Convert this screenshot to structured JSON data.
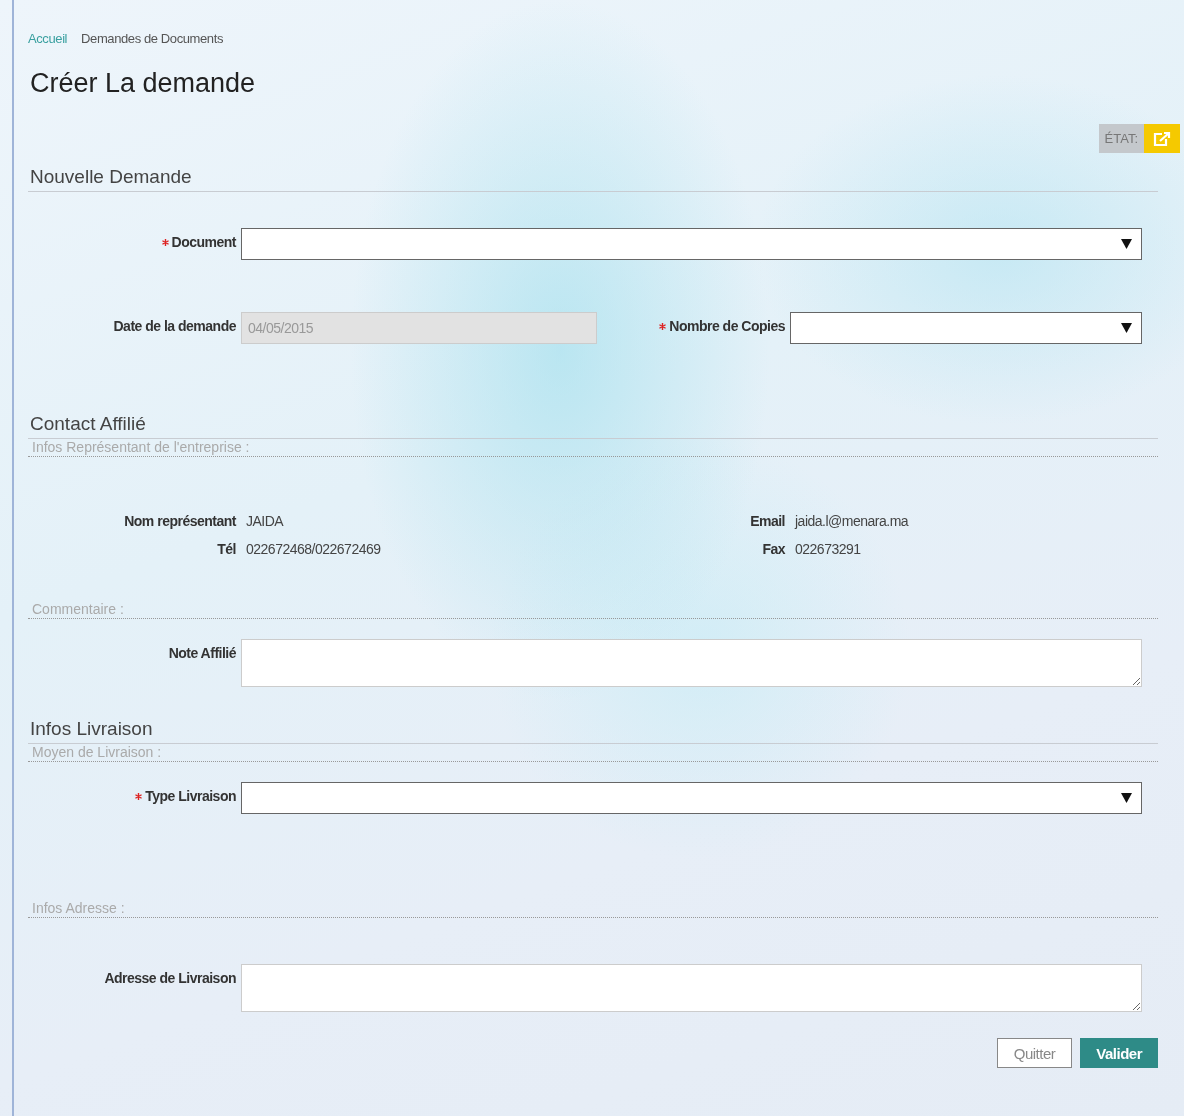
{
  "breadcrumb": [
    {
      "label": "Accueil",
      "kind": "link"
    },
    {
      "label": "Demandes de Documents",
      "kind": "current"
    }
  ],
  "title": "Créer La demande",
  "status": {
    "label": "ÉTAT:"
  },
  "sections": [
    {
      "title": "Nouvelle Demande",
      "groups": [
        {
          "rows": [
            [
              {
                "kind": "select",
                "label": "Document",
                "required": true
              }
            ],
            [
              {
                "kind": "text",
                "label": "Date de la demande",
                "value": "04/05/2015",
                "required": false,
                "disabled": true
              },
              {
                "kind": "select",
                "label": "Nombre de Copies",
                "required": true
              }
            ]
          ]
        }
      ]
    },
    {
      "title": "Contact Affilié",
      "groups": [
        {
          "title": "Infos Représentant de l'entreprise :",
          "rows": [
            [
              {
                "kind": "info",
                "label": "Nom représentant",
                "value": "JAIDA"
              },
              {
                "kind": "info",
                "label": "Email",
                "value": "jaida.l@menara.ma"
              }
            ],
            [
              {
                "kind": "info",
                "label": "Tél",
                "value": "022672468/022672469"
              },
              {
                "kind": "info",
                "label": "Fax",
                "value": "022673291"
              }
            ]
          ]
        },
        {
          "title": "Commentaire :",
          "rows": [
            [
              {
                "kind": "textarea",
                "label": "Note Affilié",
                "required": false
              }
            ]
          ]
        }
      ]
    },
    {
      "title": "Infos Livraison",
      "groups": [
        {
          "title": "Moyen de Livraison :",
          "rows": [
            [
              {
                "kind": "select",
                "label": "Type Livraison",
                "required": true
              }
            ]
          ]
        },
        {
          "title": "Infos Adresse :",
          "rows": [
            [
              {
                "kind": "textarea",
                "label": "Adresse de Livraison",
                "required": false
              }
            ]
          ]
        }
      ]
    }
  ],
  "buttons": [
    {
      "label": "Quitter",
      "kind": "secondary"
    },
    {
      "label": "Valider",
      "kind": "primary"
    }
  ]
}
